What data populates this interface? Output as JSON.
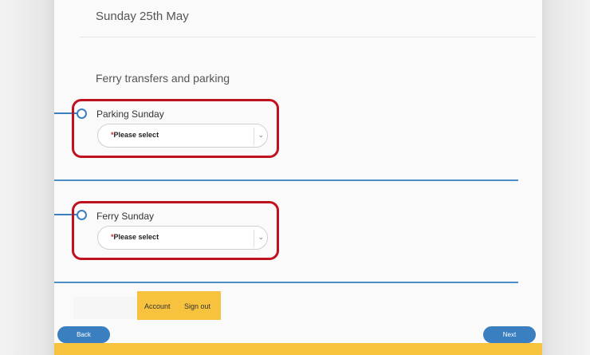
{
  "header": {
    "date": "Sunday 25th May"
  },
  "section": {
    "title": "Ferry transfers and parking"
  },
  "fields": [
    {
      "label": "Parking Sunday",
      "required_mark": "*",
      "placeholder": "Please select"
    },
    {
      "label": "Ferry Sunday",
      "required_mark": "*",
      "placeholder": "Please select"
    }
  ],
  "nav": {
    "account": "Account",
    "sign_out": "Sign out"
  },
  "buttons": {
    "back": "Back",
    "next": "Next"
  },
  "colors": {
    "accent_blue": "#3a7fc0",
    "highlight_red": "#c0111f",
    "brand_yellow": "#f7c23e"
  },
  "icons": {
    "dropdown": "chevron-down-icon",
    "step_node": "circle-node-icon"
  }
}
